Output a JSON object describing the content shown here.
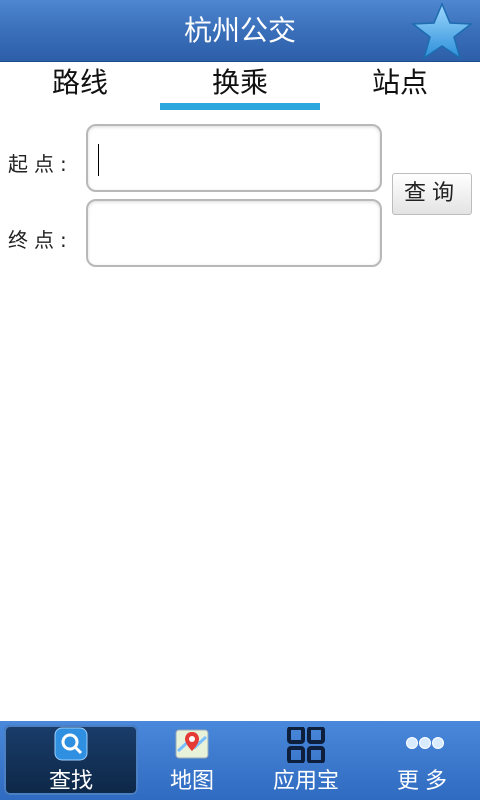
{
  "header": {
    "title": "杭州公交",
    "star_icon": "star-icon"
  },
  "tabs": [
    {
      "label": "路线"
    },
    {
      "label": "换乘",
      "selected": true
    },
    {
      "label": "站点"
    }
  ],
  "form": {
    "start_label": "起点:",
    "end_label": "终点:",
    "start_value": "",
    "end_value": "",
    "query_label": "查询"
  },
  "bottom_nav": [
    {
      "label": "查找",
      "icon": "search-icon",
      "active": true
    },
    {
      "label": "地图",
      "icon": "map-icon"
    },
    {
      "label": "应用宝",
      "icon": "grid-icon"
    },
    {
      "label": "更多",
      "icon": "more-icon"
    }
  ],
  "colors": {
    "header": "#3a6fba",
    "tab_indicator": "#2aa7dc",
    "nav": "#3b78cf"
  }
}
